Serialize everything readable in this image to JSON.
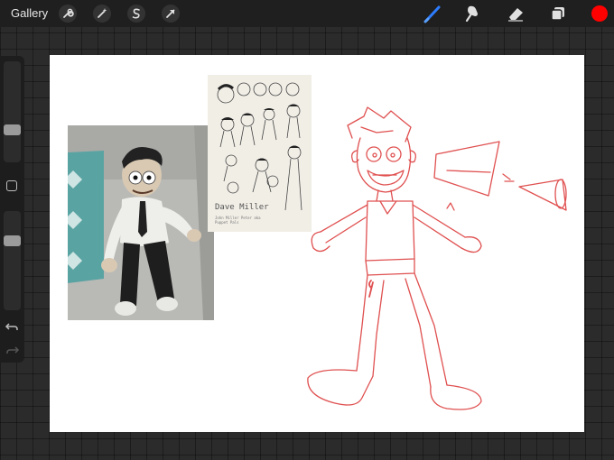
{
  "app": {
    "gallery_label": "Gallery"
  },
  "toolbar": {
    "left_tools": [
      "wrench-icon",
      "magic-wand-icon",
      "selection-s-icon",
      "arrow-transform-icon"
    ],
    "right_tools": [
      "brush-icon",
      "smudge-icon",
      "eraser-icon",
      "layers-icon"
    ],
    "active_tool": "brush-icon",
    "current_color": "#ff0000",
    "brush_accent": "#2d7dff"
  },
  "sidebar": {
    "brush_size_level": 0.3,
    "opacity_level": 0.72
  },
  "canvas": {
    "sketch_color": "#e05050",
    "reference_sheet": {
      "title": "Dave Miller",
      "subtitle_lines": [
        "John Miller Peter aka",
        "Puppet Pals"
      ]
    }
  }
}
